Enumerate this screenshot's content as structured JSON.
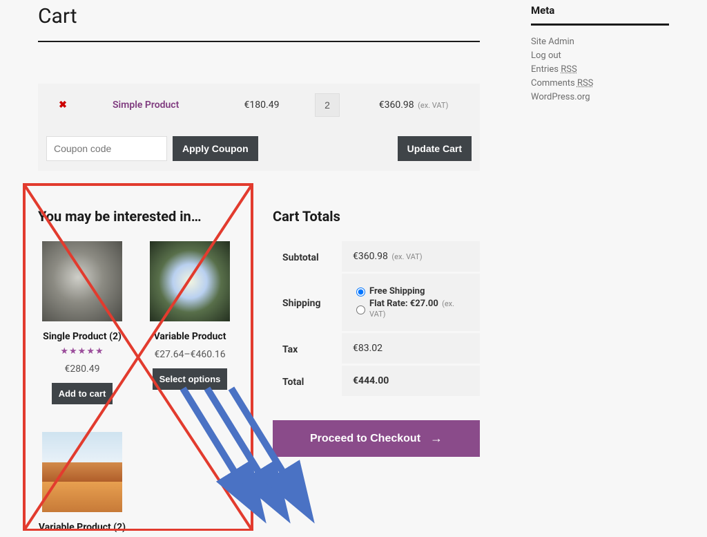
{
  "header": {
    "title": "Cart"
  },
  "cart": {
    "item": {
      "name": "Simple Product",
      "price": "€180.49",
      "qty": "2",
      "subtotal": "€360.98",
      "exvat": "(ex. VAT)"
    },
    "coupon_placeholder": "Coupon code",
    "apply_coupon": "Apply Coupon",
    "update_cart": "Update Cart"
  },
  "interest": {
    "heading": "You may be interested in…",
    "products": [
      {
        "name": "Single Product (2)",
        "price": "€280.49",
        "button": "Add to cart",
        "stars": "★★★★★"
      },
      {
        "name": "Variable Product",
        "price": "€27.64–€460.16",
        "button": "Select options"
      },
      {
        "name": "Variable Product (2)",
        "price": ""
      }
    ]
  },
  "totals": {
    "heading": "Cart Totals",
    "subtotal_label": "Subtotal",
    "subtotal_value": "€360.98",
    "subtotal_exvat": "(ex. VAT)",
    "shipping_label": "Shipping",
    "shipping_free": "Free Shipping",
    "shipping_flat": "Flat Rate: €27.00",
    "shipping_flat_exvat": "(ex. VAT)",
    "tax_label": "Tax",
    "tax_value": "€83.02",
    "total_label": "Total",
    "total_value": "€444.00",
    "checkout": "Proceed to Checkout"
  },
  "meta": {
    "title": "Meta",
    "links": {
      "site_admin": "Site Admin",
      "log_out": "Log out",
      "entries": "Entries ",
      "entries_rss": "RSS",
      "comments": "Comments ",
      "comments_rss": "RSS",
      "wp": "WordPress.org"
    }
  }
}
